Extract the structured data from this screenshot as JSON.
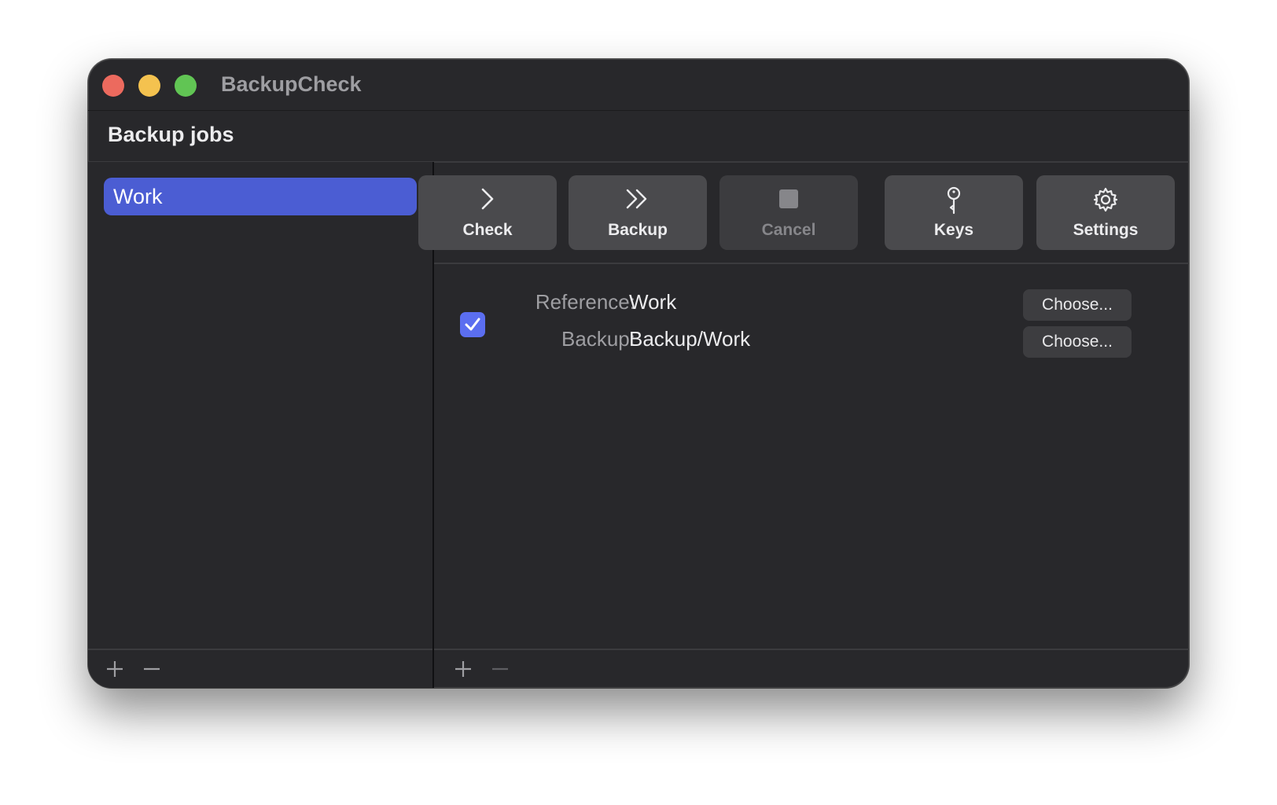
{
  "window": {
    "title": "BackupCheck"
  },
  "header": {
    "title": "Backup jobs"
  },
  "sidebar": {
    "items": [
      {
        "label": "Work",
        "selected": true
      }
    ],
    "add_icon": "plus-icon",
    "remove_icon": "minus-icon"
  },
  "toolbar": {
    "buttons": [
      {
        "label": "Check",
        "icon": "chevron-right-icon",
        "enabled": true
      },
      {
        "label": "Backup",
        "icon": "double-chevron-right-icon",
        "enabled": true
      },
      {
        "label": "Cancel",
        "icon": "stop-icon",
        "enabled": false
      },
      {
        "label": "Keys",
        "icon": "key-icon",
        "enabled": true
      },
      {
        "label": "Settings",
        "icon": "gear-icon",
        "enabled": true
      }
    ]
  },
  "pair": {
    "enabled": true,
    "reference_label": "Reference:",
    "reference_value": "Work",
    "backup_label": "Backup:",
    "backup_value": "Backup/Work",
    "choose_reference_label": "Choose...",
    "choose_backup_label": "Choose..."
  },
  "colors": {
    "accent": "#4b5dd3",
    "checkbox": "#5b6ef0",
    "window_bg": "#28282b"
  }
}
